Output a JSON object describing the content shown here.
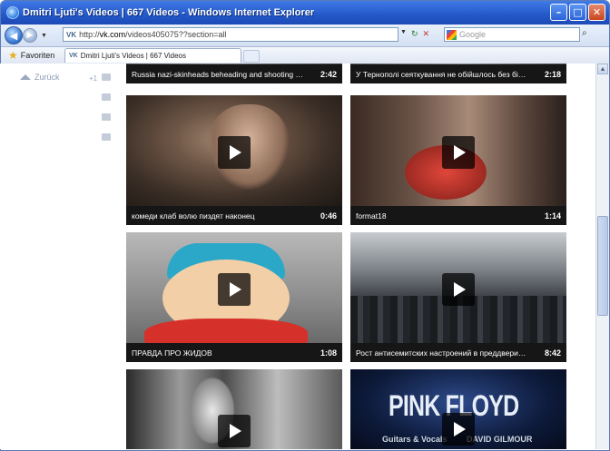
{
  "window": {
    "title": "Dmitri Ljuti's Videos | 667 Videos - Windows Internet Explorer",
    "minimize": "–",
    "maximize": "□",
    "close": "✕"
  },
  "address": {
    "url_prefix": "http://",
    "url_host": "vk.com",
    "url_path": "/videos405075??section=all",
    "search_placeholder": "Google",
    "back": "◀",
    "forward": "▶",
    "dropdown": "▼",
    "refresh": "↻",
    "stop": "✕",
    "search_go": "⌕"
  },
  "favorites": {
    "label": "Favoriten",
    "tab_title": "Dmitri Ljuti's Videos | 667 Videos"
  },
  "sidebar": {
    "back_label": "Zurück",
    "count": "+1"
  },
  "videos": [
    {
      "title": "Russia nazi-skinheads beheading and shooting of tw...",
      "duration": "2:42"
    },
    {
      "title": "У Тернополі сеяткування не обійшлось без бійки",
      "duration": "2:18"
    },
    {
      "title": "комеди клаб волю пиздят наконец",
      "duration": "0:46"
    },
    {
      "title": "format18",
      "duration": "1:14"
    },
    {
      "title": "ПРАВДА ПРО ЖИДОВ",
      "duration": "1:08"
    },
    {
      "title": "Рост антисемитских настроений в преддверии... -...",
      "duration": "8:42"
    }
  ],
  "thumb_text": {
    "pink_floyd": "PINK FLOYD",
    "guitars": "Guitars & Vocals",
    "gilmour": "DAVID GILMOUR"
  },
  "colors": {
    "title_bar": "#2458c9",
    "video_bar": "#161616",
    "vk_blue": "#45688e"
  }
}
